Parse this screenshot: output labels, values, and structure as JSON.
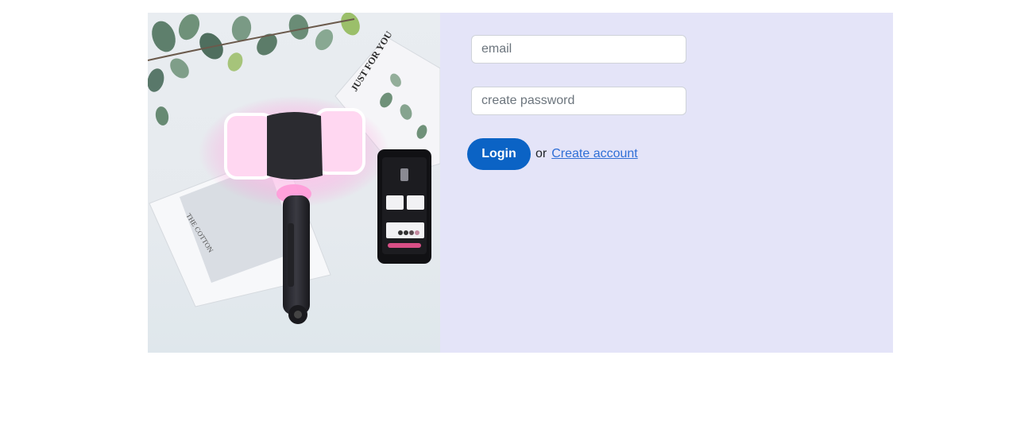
{
  "hero": {
    "image": "lightstick-product-photo",
    "card_text_top": "JUST FOR YOU",
    "card_text_bottom": "THE COTTON"
  },
  "form": {
    "email_placeholder": "email",
    "password_placeholder": "create password",
    "login_label": "Login",
    "or_text": "or",
    "create_account_label": "Create account"
  },
  "colors": {
    "panel_background": "#e4e4f8",
    "login_button": "#0b63c5",
    "link": "#2f6fd6",
    "glow": "#ff8fd6"
  }
}
